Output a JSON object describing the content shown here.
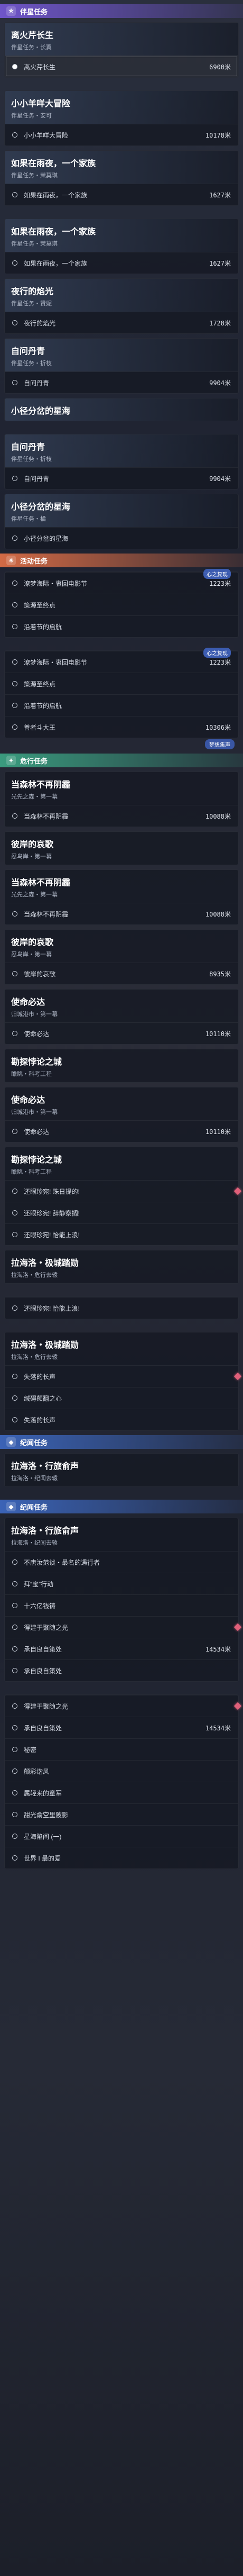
{
  "colors": {
    "companion": "#6f55c9",
    "event": "#d26a45",
    "danger": "#3a9b7e",
    "legend": "#3b63b6",
    "marker": "#e0607a"
  },
  "sections": {
    "companion": "伴星任务",
    "event": "活动任务",
    "danger": "危行任务",
    "legend": "纪闻任务",
    "legend2": "纪闻任务"
  },
  "g1": {
    "title": "离火芹长生",
    "sub": "伴星任务・长翼",
    "rows": [
      {
        "label": "离火芹长生",
        "dist": "6900米"
      }
    ]
  },
  "g2": {
    "title": "小小羊咩大冒险",
    "sub": "伴星任务・安可",
    "rows": [
      {
        "label": "小小羊咩大冒险",
        "dist": "10178米"
      }
    ]
  },
  "g3": {
    "title": "如果在雨夜，一个家族",
    "sub": "伴星任务・茉莫琪",
    "rows": [
      {
        "label": "如果在雨夜，一个家族",
        "dist": "1627米"
      }
    ]
  },
  "g4": {
    "title": "如果在雨夜，一个家族",
    "sub": "伴星任务・茉莫琪",
    "rows": [
      {
        "label": "如果在雨夜，一个家族",
        "dist": "1627米"
      }
    ]
  },
  "g5": {
    "title": "夜行的焰光",
    "sub": "伴星任务・赞妮",
    "rows": [
      {
        "label": "夜行的焰光",
        "dist": "1728米"
      }
    ]
  },
  "g6": {
    "title": "自问丹青",
    "sub": "伴星任务・折枝",
    "rows": [
      {
        "label": "自问丹青",
        "dist": "9904米"
      }
    ]
  },
  "g7": {
    "title": "小径分岔的星海",
    "sub": "",
    "rows": []
  },
  "g8": {
    "title": "自问丹青",
    "sub": "伴星任务・折枝",
    "rows": [
      {
        "label": "自问丹青",
        "dist": "9904米"
      }
    ]
  },
  "g9": {
    "title": "小径分岔的星海",
    "sub": "伴星任务・橘",
    "rows": [
      {
        "label": "小径分岔的星海",
        "dist": ""
      }
    ]
  },
  "e1": {
    "badge": "心之复现",
    "rows": [
      {
        "label": "潦梦海际・衷回电影节",
        "dist": "1223米"
      },
      {
        "label": "策源至终点",
        "dist": ""
      },
      {
        "label": "沿着节的启航",
        "dist": ""
      }
    ]
  },
  "e2": {
    "badge": "心之复现",
    "rows": [
      {
        "label": "潦梦海际・衷回电影节",
        "dist": "1223米"
      },
      {
        "label": "策源至终点",
        "dist": ""
      },
      {
        "label": "沿着节的启航",
        "dist": ""
      },
      {
        "label": "善者斗大王",
        "dist": "10306米"
      }
    ]
  },
  "floating_marker": "梦想集声",
  "d1": {
    "title": "当森林不再阴霾",
    "sub": "光先之森・第一幕",
    "rows": [
      {
        "label": "当森林不再阴霾",
        "dist": "10088米"
      }
    ]
  },
  "d2": {
    "title": "彼岸的哀歌",
    "sub": "忍鸟岸・第一幕",
    "rows": []
  },
  "d3": {
    "title": "当森林不再阴霾",
    "sub": "光先之森・第一幕",
    "rows": [
      {
        "label": "当森林不再阴霾",
        "dist": "10088米"
      }
    ]
  },
  "d4": {
    "title": "彼岸的哀歌",
    "sub": "忍鸟岸・第一幕",
    "rows": [
      {
        "label": "彼岸的哀歌",
        "dist": "8935米"
      }
    ]
  },
  "d5": {
    "title": "使命必达",
    "sub": "归城港市・第一幕",
    "rows": [
      {
        "label": "使命必达",
        "dist": "10110米"
      }
    ]
  },
  "d6": {
    "title": "勘探悖论之城",
    "sub": "瞻眺・科考工程",
    "rows": []
  },
  "d7": {
    "title": "使命必达",
    "sub": "归城港市・第一幕",
    "rows": [
      {
        "label": "使命必达",
        "dist": "10110米"
      }
    ]
  },
  "d8": {
    "title": "勘探悖论之城",
    "sub": "瞻眺・科考工程",
    "rows": [
      {
        "label": "还眼珍宛! 珠日提的!",
        "dist": ""
      },
      {
        "label": "还眼珍宛! 辞静察搁!",
        "dist": ""
      },
      {
        "label": "还眼珍宛! 怡能上浪!",
        "dist": ""
      }
    ]
  },
  "d9": {
    "title": "拉海洛・极城踏勋",
    "sub": "拉海洛・危行去辕",
    "rows": []
  },
  "d10": {
    "title": "",
    "sub": "",
    "rows": [
      {
        "label": "还眼珍宛! 怡能上浪!",
        "dist": ""
      }
    ]
  },
  "d11": {
    "title": "拉海洛・极城踏勋",
    "sub": "拉海洛・危行去辕",
    "rows": [
      {
        "label": "失落的长声",
        "dist": ""
      },
      {
        "label": "缄碍颠翻之心",
        "dist": ""
      },
      {
        "label": "失落的长声",
        "dist": ""
      }
    ]
  },
  "l1": {
    "title": "拉海洛・行旅俞声",
    "sub": "拉海洛・纪闻去辕",
    "rows": []
  },
  "l2": {
    "title": "拉海洛・行旅俞声",
    "sub": "拉海洛・纪闻去辕",
    "rows": [
      {
        "label": "不唐汝范谈・最名的遇行者",
        "dist": ""
      },
      {
        "label": "拜“宝”行动",
        "dist": ""
      },
      {
        "label": "十六亿钱铸",
        "dist": ""
      },
      {
        "label": "得建于聚随之光",
        "dist": ""
      },
      {
        "label": "承自良自策处",
        "dist": "14534米"
      },
      {
        "label": "承自良自策处",
        "dist": ""
      }
    ]
  },
  "l3": {
    "title": "",
    "sub": "",
    "rows": [
      {
        "label": "得建于聚随之光",
        "dist": ""
      },
      {
        "label": "承自良自策处",
        "dist": "14534米"
      },
      {
        "label": "秘密",
        "dist": ""
      },
      {
        "label": "颠彩谐风",
        "dist": ""
      },
      {
        "label": "属轻来的童军",
        "dist": ""
      },
      {
        "label": "甜光俞空里陂影",
        "dist": ""
      },
      {
        "label": "星海陷间 (一)",
        "dist": ""
      },
      {
        "label": "世界 I 最的爱",
        "dist": ""
      }
    ]
  }
}
